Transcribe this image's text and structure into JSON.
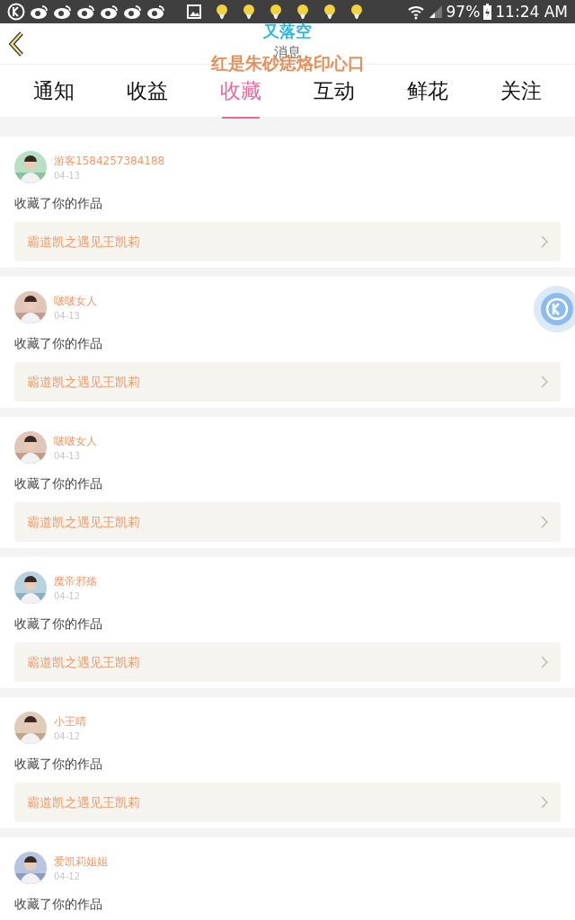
{
  "status_bar": {
    "battery": "97%",
    "time": "11:24 AM"
  },
  "header": {
    "title": "消息"
  },
  "lyrics_overlay": {
    "lines": [
      "又落空",
      "红是朱砂痣烙印心口"
    ]
  },
  "tabs": [
    {
      "label": "通知",
      "selected": false
    },
    {
      "label": "收益",
      "selected": false
    },
    {
      "label": "收藏",
      "selected": true
    },
    {
      "label": "互动",
      "selected": false
    },
    {
      "label": "鲜花",
      "selected": false
    },
    {
      "label": "关注",
      "selected": false
    }
  ],
  "messages": [
    {
      "user": "游客1584257384188",
      "date": "04-13",
      "action": "收藏了你的作品",
      "work": "霸道凯之遇见王凯莉"
    },
    {
      "user": "啵啵女人",
      "date": "04-13",
      "action": "收藏了你的作品",
      "work": "霸道凯之遇见王凯莉"
    },
    {
      "user": "啵啵女人",
      "date": "04-13",
      "action": "收藏了你的作品",
      "work": "霸道凯之遇见王凯莉"
    },
    {
      "user": "魔帝邪殇",
      "date": "04-12",
      "action": "收藏了你的作品",
      "work": "霸道凯之遇见王凯莉"
    },
    {
      "user": "小王晴",
      "date": "04-12",
      "action": "收藏了你的作品",
      "work": "霸道凯之遇见王凯莉"
    },
    {
      "user": "爱凯莉姐姐",
      "date": "04-12",
      "action": "收藏了你的作品"
    }
  ]
}
